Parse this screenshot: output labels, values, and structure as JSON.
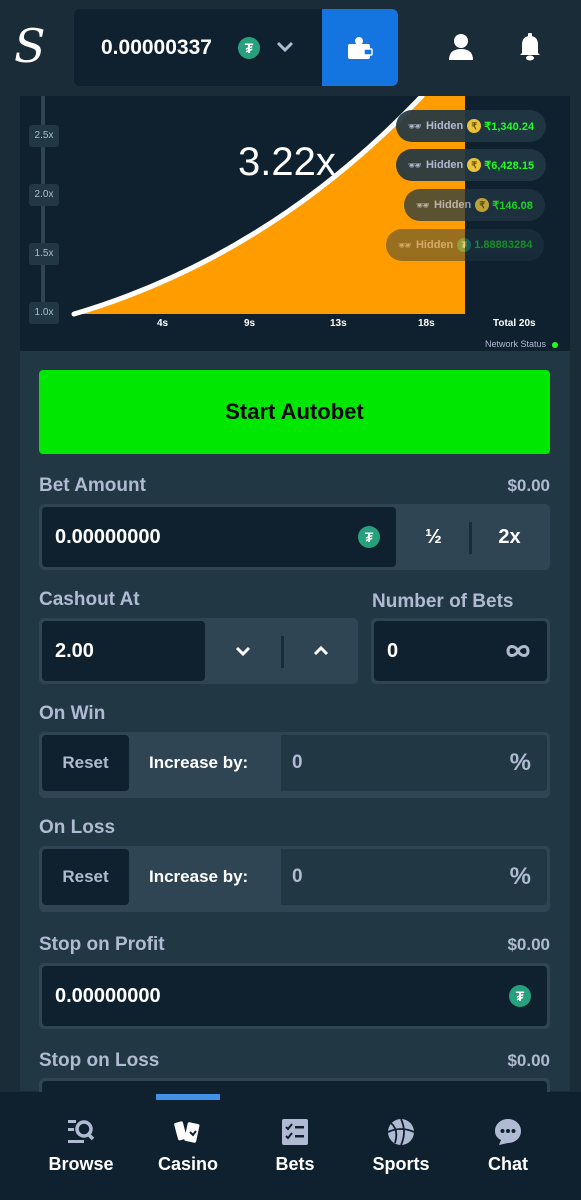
{
  "header": {
    "logo": "S",
    "balance": "0.00000337",
    "currency_icon": "tether-icon",
    "colors": {
      "wallet_button": "#1475e1",
      "tether": "#26a17b"
    }
  },
  "game": {
    "current_multiplier": "3.22x",
    "y_ticks": [
      "2.5x",
      "2.0x",
      "1.5x",
      "1.0x"
    ],
    "x_ticks": [
      "4s",
      "9s",
      "13s",
      "18s",
      "Total 20s"
    ],
    "network_status_label": "Network Status",
    "network_status_color": "#1fff20",
    "curve_fill_color": "#ff9d00",
    "players": [
      {
        "name": "Hidden",
        "currency": "inr",
        "amount": "₹1,340.24",
        "opacity": 1.0
      },
      {
        "name": "Hidden",
        "currency": "inr",
        "amount": "₹6,428.15",
        "opacity": 1.0
      },
      {
        "name": "Hidden",
        "currency": "inr",
        "amount": "₹146.08",
        "opacity": 0.75
      },
      {
        "name": "Hidden",
        "currency": "usdt",
        "amount": "1.88883284",
        "opacity": 0.45
      }
    ]
  },
  "controls": {
    "start_button": "Start Autobet",
    "start_button_color": "#00e701",
    "bet_amount": {
      "label": "Bet Amount",
      "usd": "$0.00",
      "value": "0.00000000",
      "half": "½",
      "double": "2x"
    },
    "cashout_at": {
      "label": "Cashout At",
      "value": "2.00"
    },
    "number_of_bets": {
      "label": "Number of Bets",
      "value": "0",
      "icon": "infinity-icon"
    },
    "on_win": {
      "label": "On Win",
      "reset": "Reset",
      "increase_label": "Increase by:",
      "value": "0",
      "unit": "%"
    },
    "on_loss": {
      "label": "On Loss",
      "reset": "Reset",
      "increase_label": "Increase by:",
      "value": "0",
      "unit": "%"
    },
    "stop_on_profit": {
      "label": "Stop on Profit",
      "usd": "$0.00",
      "value": "0.00000000"
    },
    "stop_on_loss": {
      "label": "Stop on Loss",
      "usd": "$0.00"
    }
  },
  "bottom_nav": {
    "active": "Casino",
    "items": [
      {
        "label": "Browse",
        "icon": "browse-icon"
      },
      {
        "label": "Casino",
        "icon": "casino-cards-icon"
      },
      {
        "label": "Bets",
        "icon": "bets-checklist-icon"
      },
      {
        "label": "Sports",
        "icon": "basketball-icon"
      },
      {
        "label": "Chat",
        "icon": "chat-icon"
      }
    ]
  }
}
